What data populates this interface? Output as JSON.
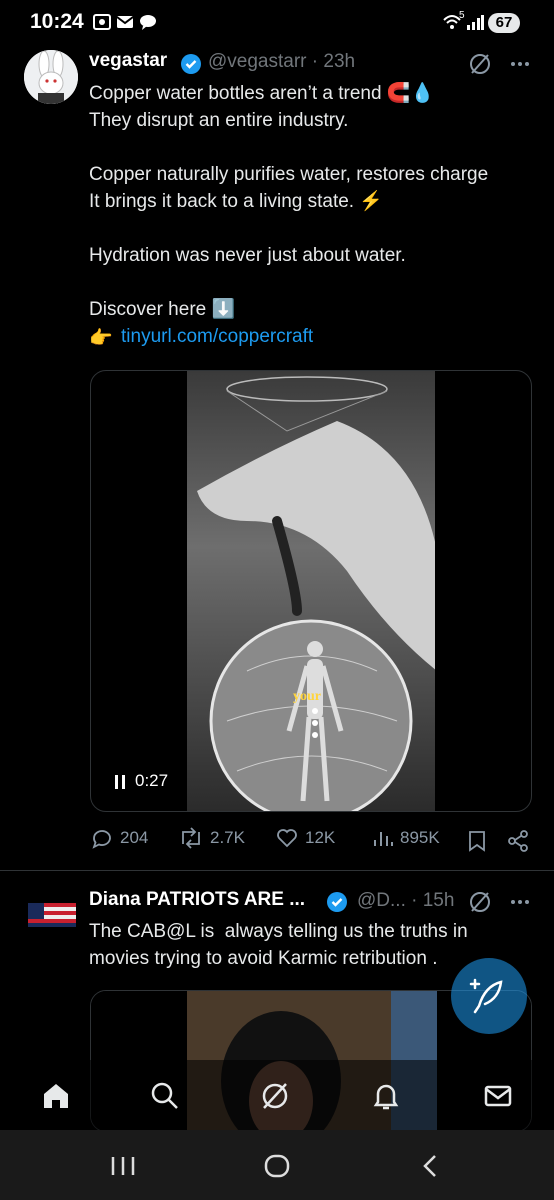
{
  "status": {
    "time": "10:24",
    "signal_label": "5",
    "battery": "67"
  },
  "tweet1": {
    "name": "vegastar",
    "handle_time": "@vegastarr · 23h",
    "text": "Copper water bottles aren’t a trend 🧲💧\nThey disrupt an entire industry.\n\nCopper naturally purifies water, restores charge\nIt brings it back to a living state. ⚡\n\nHydration was never just about water.\n\nDiscover here ⬇️",
    "link_prefix": "👉",
    "link": "tinyurl.com/coppercraft",
    "video_time": "0:27",
    "video_caption": "your",
    "replies": "204",
    "reposts": "2.7K",
    "likes": "12K",
    "views": "895K"
  },
  "tweet2": {
    "name": "Diana PATRIOTS ARE ...",
    "handle_time": "@D... · 15h",
    "text": "The CAB@L is  always telling us the truths in movies trying to avoid Karmic retribution ."
  },
  "colors": {
    "accent": "#1d9bf0",
    "muted": "#71767b",
    "verified": "#1d9bf0"
  }
}
